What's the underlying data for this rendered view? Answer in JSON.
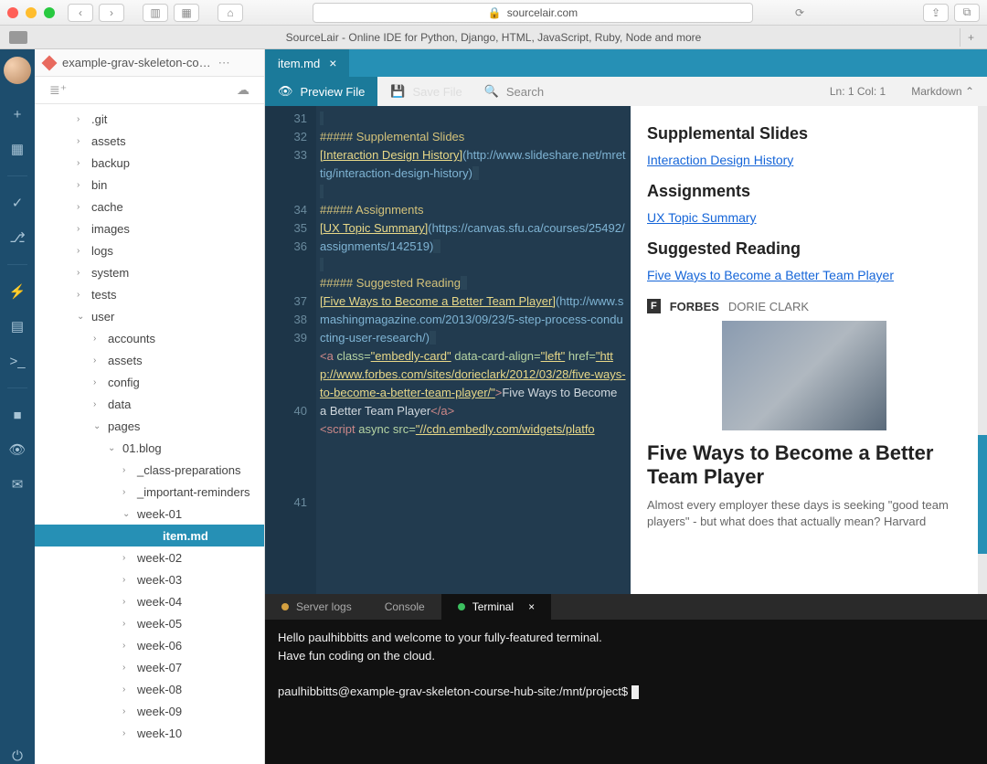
{
  "browser": {
    "address": "sourcelair.com",
    "tab_title": "SourceLair - Online IDE for Python, Django, HTML, JavaScript, Ruby, Node and more"
  },
  "project": {
    "name": "example-grav-skeleton-co…"
  },
  "tree": {
    "roots": [
      ".git",
      "assets",
      "backup",
      "bin",
      "cache",
      "images",
      "logs",
      "system",
      "tests"
    ],
    "user": "user",
    "user_children": [
      "accounts",
      "assets",
      "config",
      "data"
    ],
    "pages": "pages",
    "blog": "01.blog",
    "blog_children_top": [
      "_class-preparations",
      "_important-reminders"
    ],
    "week_open": "week-01",
    "active_file": "item.md",
    "weeks": [
      "week-02",
      "week-03",
      "week-04",
      "week-05",
      "week-06",
      "week-07",
      "week-08",
      "week-09",
      "week-10"
    ]
  },
  "tabs": {
    "file": "item.md"
  },
  "actions": {
    "preview": "Preview File",
    "save": "Save File",
    "search": "Search",
    "status": "Ln: 1 Col: 1",
    "mode": "Markdown"
  },
  "code": {
    "lines": [
      "31",
      "32",
      "33",
      "34",
      "35",
      "36",
      "37",
      "38",
      "39",
      "40",
      "41"
    ],
    "h_supp": "##### Supplemental Slides",
    "lnk_idh": "[Interaction Design History]",
    "url_idh": "(http://www.slideshare.net/mrettig/interaction-design-history)",
    "h_assign": "##### Assignments",
    "lnk_ux": "[UX Topic Summary]",
    "url_ux": "(https://canvas.sfu.ca/courses/25492/assignments/142519)",
    "h_sugg": "##### Suggested Reading",
    "lnk_five": "[Five Ways to Become a Better Team Player]",
    "url_five": "(http://www.smashingmagazine.com/2013/09/23/5-step-process-conducting-user-research/)",
    "a_open": "<a class=\"embedly-card\" data-card-align=\"left\" href=\"",
    "a_href": "http://www.forbes.com/sites/dorieclark/2012/03/28/five-ways-to-become-a-better-team-player/",
    "a_text": "\">Five Ways to Become a Better Team Player</a>",
    "script_open": "<script async src=\"",
    "script_src": "//cdn.embedly.com/widgets/platfo"
  },
  "preview": {
    "h_supp": "Supplemental Slides",
    "a_idh": "Interaction Design History",
    "h_assign": "Assignments",
    "a_ux": "UX Topic Summary",
    "h_sugg": "Suggested Reading",
    "a_five": "Five Ways to Become a Better Team Player",
    "forbes": "FORBES",
    "author": "DORIE CLARK",
    "card_title": "Five Ways to Become a Better Team Player",
    "card_desc": "Almost every employer these days is seeking \"good team players\" - but what does that actually mean? Harvard"
  },
  "panel": {
    "tabs": {
      "server": "Server logs",
      "console": "Console",
      "terminal": "Terminal"
    },
    "term_line1": "Hello paulhibbitts and welcome to your fully-featured terminal.",
    "term_line2": "Have fun coding on the cloud.",
    "prompt": "paulhibbitts@example-grav-skeleton-course-hub-site:/mnt/project$ "
  }
}
